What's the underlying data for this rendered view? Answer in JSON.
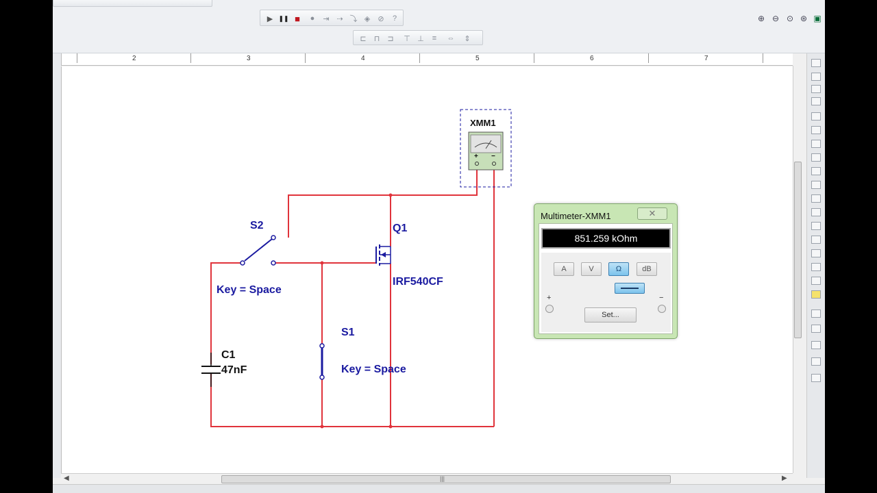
{
  "toolbar": {
    "sim_run": "▶",
    "sim_pause": "❚❚",
    "sim_stop": "■"
  },
  "ruler": {
    "labels": [
      "2",
      "3",
      "4",
      "5",
      "6",
      "7"
    ]
  },
  "schematic": {
    "multimeter_label": "XMM1",
    "plus": "+",
    "minus": "−",
    "s2_label": "S2",
    "s2_key": "Key = Space",
    "q1_label": "Q1",
    "q1_part": "IRF540CF",
    "s1_label": "S1",
    "s1_key": "Key = Space",
    "c1_label": "C1",
    "c1_value": "47nF",
    "wire_color": "#e0333b",
    "component_color": "#1a1aa0"
  },
  "multimeter": {
    "title": "Multimeter-XMM1",
    "close": "✕",
    "reading": "851.259 kOhm",
    "buttons": [
      "A",
      "V",
      "Ω",
      "dB"
    ],
    "active_button": "Ω",
    "set_label": "Set...",
    "plus": "+",
    "minus": "−"
  },
  "scroll": {
    "h_thumb_grip": "|||"
  }
}
